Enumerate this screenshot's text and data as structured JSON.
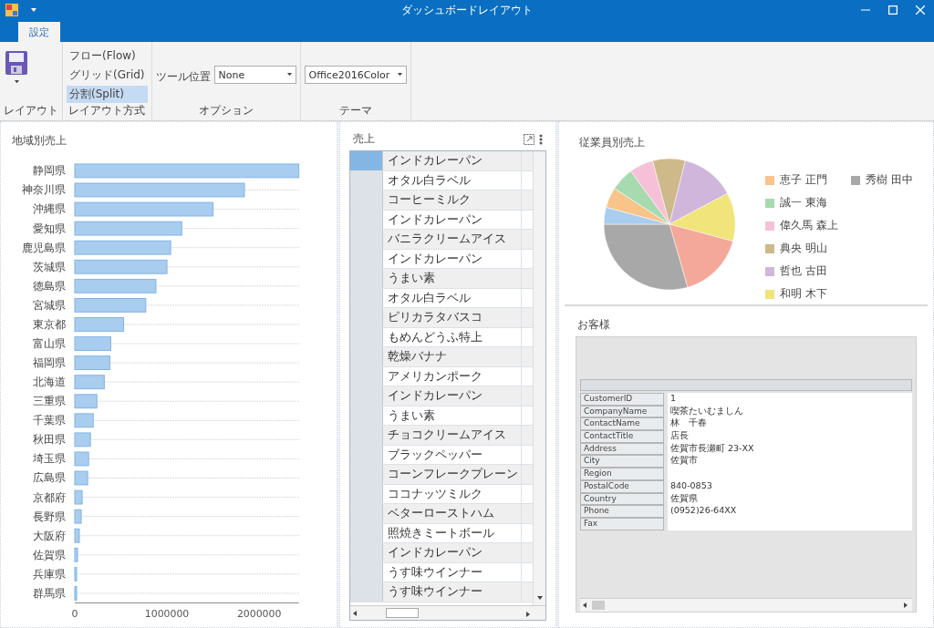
{
  "window": {
    "title": "ダッシュボードレイアウト"
  },
  "ribbon": {
    "tabs": [
      {
        "label": "設定",
        "selected": true
      }
    ],
    "groups": [
      {
        "kind": "save",
        "label": "レイアウト"
      },
      {
        "kind": "modes",
        "label": "レイアウト方式",
        "items": [
          {
            "label": "フロー(Flow)",
            "selected": false
          },
          {
            "label": "グリッド(Grid)",
            "selected": false
          },
          {
            "label": "分割(Split)",
            "selected": true
          }
        ]
      },
      {
        "kind": "combo",
        "label": "オプション",
        "field_label": "ツール位置",
        "value": "None"
      },
      {
        "kind": "combo",
        "label": "テーマ",
        "value": "Office2016Color"
      }
    ]
  },
  "region_sales": {
    "title": "地域別売上",
    "chart_data": {
      "type": "bar",
      "orientation": "horizontal",
      "categories": [
        "静岡県",
        "神奈川県",
        "沖縄県",
        "愛知県",
        "鹿児島県",
        "茨城県",
        "徳島県",
        "宮城県",
        "東京都",
        "富山県",
        "福岡県",
        "北海道",
        "三重県",
        "千葉県",
        "秋田県",
        "埼玉県",
        "広島県",
        "京都府",
        "長野県",
        "大阪府",
        "佐賀県",
        "兵庫県",
        "群馬県"
      ],
      "series": [
        {
          "color": "#a9cdef",
          "values": [
            2430000,
            1840000,
            1500000,
            1160000,
            1040000,
            1000000,
            880000,
            770000,
            530000,
            390000,
            380000,
            320000,
            240000,
            200000,
            170000,
            150000,
            140000,
            80000,
            70000,
            50000,
            30000,
            20000,
            20000
          ]
        }
      ],
      "xlim": [
        0,
        2430000
      ],
      "xticks": [
        0,
        1000000,
        2000000
      ]
    }
  },
  "sales_grid": {
    "title": "売上",
    "rows": [
      {
        "product": "インドカレーパン",
        "selected": true
      },
      {
        "product": "オタル白ラベル",
        "selected": false
      },
      {
        "product": "コーヒーミルク",
        "selected": false
      },
      {
        "product": "インドカレーパン",
        "selected": false
      },
      {
        "product": "バニラクリームアイス",
        "selected": false
      },
      {
        "product": "インドカレーパン",
        "selected": false
      },
      {
        "product": "うまい素",
        "selected": false
      },
      {
        "product": "オタル白ラベル",
        "selected": false
      },
      {
        "product": "ピリカラタバスコ",
        "selected": false
      },
      {
        "product": "もめんどうふ特上",
        "selected": false
      },
      {
        "product": "乾燥バナナ",
        "selected": false
      },
      {
        "product": "アメリカンポーク",
        "selected": false
      },
      {
        "product": "インドカレーパン",
        "selected": false
      },
      {
        "product": "うまい素",
        "selected": false
      },
      {
        "product": "チョコクリームアイス",
        "selected": false
      },
      {
        "product": "ブラックペッパー",
        "selected": false
      },
      {
        "product": "コーンフレークプレーン",
        "selected": false
      },
      {
        "product": "ココナッツミルク",
        "selected": false
      },
      {
        "product": "ベターローストハム",
        "selected": false
      },
      {
        "product": "照焼きミートボール",
        "selected": false
      },
      {
        "product": "インドカレーパン",
        "selected": false
      },
      {
        "product": "うす味ウインナー",
        "selected": false
      },
      {
        "product": "うす味ウインナー",
        "selected": false
      }
    ]
  },
  "employee_sales": {
    "title": "従業員別売上",
    "legend": [
      {
        "name": "恵子 正門",
        "color": "#f8c48a"
      },
      {
        "name": "誠一 東海",
        "color": "#a8dab0"
      },
      {
        "name": "偉久馬 森上",
        "color": "#f6c0d8"
      },
      {
        "name": "典央 明山",
        "color": "#cdb98a"
      },
      {
        "name": "哲也 古田",
        "color": "#cfb6da"
      },
      {
        "name": "和明 木下",
        "color": "#f0e47a"
      },
      {
        "name": "秀樹 田中",
        "color": "#a8a8a8"
      }
    ]
  },
  "customers": {
    "title": "お客様",
    "fields": [
      {
        "name": "CustomerID",
        "value": "1"
      },
      {
        "name": "CompanyName",
        "value": "喫茶たいむましん"
      },
      {
        "name": "ContactName",
        "value": "林　千春"
      },
      {
        "name": "ContactTitle",
        "value": "店長"
      },
      {
        "name": "Address",
        "value": "佐賀市長瀬町 23-XX"
      },
      {
        "name": "City",
        "value": "佐賀市"
      },
      {
        "name": "Region"
      },
      {
        "name": "PostalCode",
        "value": "840-0853"
      },
      {
        "name": "Country",
        "value": "佐賀県"
      },
      {
        "name": "Phone",
        "value": "(0952)26-64XX"
      },
      {
        "name": "Fax"
      }
    ]
  }
}
